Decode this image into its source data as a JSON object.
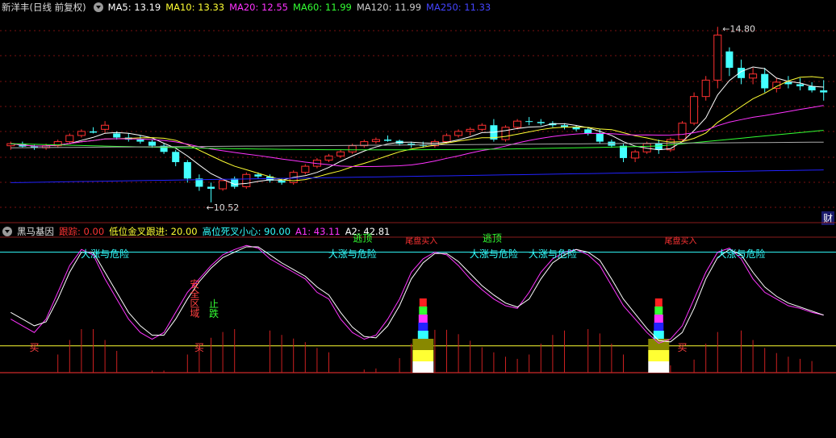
{
  "header": {
    "stock": "新洋丰(日线 前复权)",
    "items": [
      {
        "label": "MA5: 13.19",
        "color": "#ffffff"
      },
      {
        "label": "MA10: 13.33",
        "color": "#ffff33"
      },
      {
        "label": "MA20: 12.55",
        "color": "#ff33ff"
      },
      {
        "label": "MA60: 11.99",
        "color": "#33ff33"
      },
      {
        "label": "MA120: 11.99",
        "color": "#cccccc"
      },
      {
        "label": "MA250: 11.33",
        "color": "#3333ff"
      }
    ]
  },
  "indicator": {
    "name": "黑马基因",
    "items": [
      {
        "label": "跟踪: 0.00",
        "color": "#ff3333"
      },
      {
        "label": "低位金叉跟进: 20.00",
        "color": "#ffff33"
      },
      {
        "label": "高位死叉小心: 90.00",
        "color": "#33ffff"
      },
      {
        "label": "A1: 43.11",
        "color": "#ff33ff"
      },
      {
        "label": "A2: 42.81",
        "color": "#ffffff"
      }
    ]
  },
  "right_tag": "财",
  "price_labels": {
    "high": "14.80",
    "low": "10.52"
  },
  "annotations": {
    "danger": "大涨与危险",
    "escape": "逃顶",
    "buy": "买",
    "safe": "安全区域",
    "stop": "止跌",
    "tail": "尾盘买入"
  },
  "chart_data": {
    "type": "candlestick",
    "title": "新洋丰(日线 前复权)",
    "candles": [
      [
        11.9,
        12.0,
        11.8,
        11.95
      ],
      [
        11.95,
        12.0,
        11.85,
        11.88
      ],
      [
        11.88,
        11.92,
        11.8,
        11.85
      ],
      [
        11.85,
        11.95,
        11.8,
        11.9
      ],
      [
        11.9,
        12.05,
        11.85,
        12.0
      ],
      [
        12.0,
        12.2,
        11.95,
        12.15
      ],
      [
        12.15,
        12.3,
        12.1,
        12.25
      ],
      [
        12.25,
        12.35,
        12.2,
        12.22
      ],
      [
        12.3,
        12.5,
        12.2,
        12.4
      ],
      [
        12.2,
        12.25,
        12.05,
        12.1
      ],
      [
        12.1,
        12.2,
        12.0,
        12.05
      ],
      [
        12.05,
        12.15,
        11.95,
        12.0
      ],
      [
        12.0,
        12.05,
        11.85,
        11.9
      ],
      [
        11.9,
        11.95,
        11.7,
        11.75
      ],
      [
        11.75,
        11.8,
        11.4,
        11.5
      ],
      [
        11.5,
        11.55,
        11.0,
        11.1
      ],
      [
        11.1,
        11.2,
        10.8,
        10.9
      ],
      [
        10.9,
        11.0,
        10.52,
        10.85
      ],
      [
        10.85,
        11.1,
        10.8,
        11.05
      ],
      [
        11.1,
        11.15,
        10.85,
        10.9
      ],
      [
        10.9,
        11.25,
        10.85,
        11.2
      ],
      [
        11.2,
        11.25,
        11.1,
        11.15
      ],
      [
        11.15,
        11.2,
        11.0,
        11.05
      ],
      [
        11.05,
        11.1,
        10.95,
        11.0
      ],
      [
        11.0,
        11.3,
        10.95,
        11.25
      ],
      [
        11.25,
        11.45,
        11.2,
        11.4
      ],
      [
        11.4,
        11.6,
        11.35,
        11.55
      ],
      [
        11.55,
        11.7,
        11.5,
        11.65
      ],
      [
        11.65,
        11.8,
        11.6,
        11.75
      ],
      [
        11.75,
        11.95,
        11.7,
        11.9
      ],
      [
        11.9,
        12.05,
        11.85,
        12.0
      ],
      [
        12.0,
        12.1,
        11.95,
        12.05
      ],
      [
        12.05,
        12.15,
        12.0,
        12.02
      ],
      [
        12.02,
        12.05,
        11.9,
        11.95
      ],
      [
        11.95,
        12.0,
        11.85,
        11.92
      ],
      [
        11.92,
        12.0,
        11.85,
        11.9
      ],
      [
        11.9,
        12.05,
        11.85,
        12.0
      ],
      [
        12.0,
        12.2,
        11.95,
        12.15
      ],
      [
        12.15,
        12.3,
        12.1,
        12.25
      ],
      [
        12.25,
        12.35,
        12.15,
        12.3
      ],
      [
        12.3,
        12.45,
        12.25,
        12.4
      ],
      [
        12.4,
        12.55,
        12.0,
        12.05
      ],
      [
        12.05,
        12.4,
        12.0,
        12.35
      ],
      [
        12.35,
        12.55,
        12.3,
        12.5
      ],
      [
        12.5,
        12.6,
        12.4,
        12.48
      ],
      [
        12.48,
        12.55,
        12.4,
        12.45
      ],
      [
        12.45,
        12.5,
        12.35,
        12.4
      ],
      [
        12.4,
        12.45,
        12.3,
        12.35
      ],
      [
        12.35,
        12.4,
        12.25,
        12.3
      ],
      [
        12.3,
        12.35,
        12.15,
        12.2
      ],
      [
        12.2,
        12.3,
        11.95,
        12.0
      ],
      [
        12.0,
        12.05,
        11.85,
        11.9
      ],
      [
        11.9,
        11.95,
        11.5,
        11.6
      ],
      [
        11.6,
        11.8,
        11.5,
        11.75
      ],
      [
        11.75,
        12.0,
        11.7,
        11.95
      ],
      [
        11.95,
        12.05,
        11.7,
        11.8
      ],
      [
        11.8,
        12.1,
        11.75,
        12.05
      ],
      [
        12.05,
        12.5,
        12.0,
        12.45
      ],
      [
        12.45,
        13.2,
        12.4,
        13.1
      ],
      [
        13.1,
        13.6,
        13.0,
        13.5
      ],
      [
        13.5,
        14.8,
        13.3,
        14.6
      ],
      [
        14.2,
        14.3,
        13.6,
        13.8
      ],
      [
        13.8,
        14.0,
        13.4,
        13.55
      ],
      [
        13.55,
        13.8,
        13.4,
        13.65
      ],
      [
        13.65,
        13.8,
        13.2,
        13.3
      ],
      [
        13.3,
        13.55,
        13.2,
        13.45
      ],
      [
        13.45,
        13.6,
        13.3,
        13.4
      ],
      [
        13.4,
        13.55,
        13.25,
        13.35
      ],
      [
        13.35,
        13.45,
        13.2,
        13.25
      ],
      [
        13.25,
        13.5,
        13.0,
        13.2
      ]
    ],
    "ylim": [
      10.3,
      15.1
    ],
    "series": [
      {
        "name": "MA5",
        "values": [
          13.19
        ]
      },
      {
        "name": "MA10",
        "values": [
          13.33
        ]
      },
      {
        "name": "MA20",
        "values": [
          12.55
        ]
      },
      {
        "name": "MA60",
        "values": [
          11.99
        ]
      },
      {
        "name": "MA120",
        "values": [
          11.99
        ]
      },
      {
        "name": "MA250",
        "values": [
          11.33
        ]
      }
    ],
    "indicator": {
      "name": "黑马基因",
      "reference_lines": [
        0,
        20,
        90
      ],
      "A1": [
        40,
        35,
        30,
        40,
        60,
        80,
        92,
        88,
        70,
        55,
        40,
        30,
        25,
        30,
        45,
        60,
        70,
        80,
        88,
        92,
        95,
        93,
        85,
        80,
        75,
        70,
        60,
        55,
        40,
        30,
        25,
        28,
        40,
        55,
        75,
        85,
        90,
        88,
        80,
        70,
        62,
        55,
        50,
        48,
        60,
        75,
        85,
        90,
        92,
        88,
        80,
        65,
        50,
        40,
        30,
        22,
        25,
        35,
        55,
        75,
        90,
        93,
        85,
        70,
        60,
        55,
        50,
        48,
        45,
        43
      ],
      "A2": [
        45,
        40,
        35,
        38,
        55,
        75,
        90,
        90,
        75,
        60,
        45,
        35,
        28,
        28,
        40,
        55,
        68,
        78,
        86,
        90,
        94,
        94,
        88,
        82,
        77,
        72,
        64,
        58,
        45,
        34,
        27,
        26,
        35,
        50,
        70,
        82,
        89,
        89,
        83,
        74,
        65,
        58,
        52,
        49,
        55,
        70,
        82,
        88,
        92,
        90,
        84,
        70,
        55,
        44,
        33,
        24,
        23,
        30,
        48,
        70,
        86,
        92,
        88,
        75,
        64,
        57,
        52,
        49,
        46,
        43
      ]
    }
  }
}
